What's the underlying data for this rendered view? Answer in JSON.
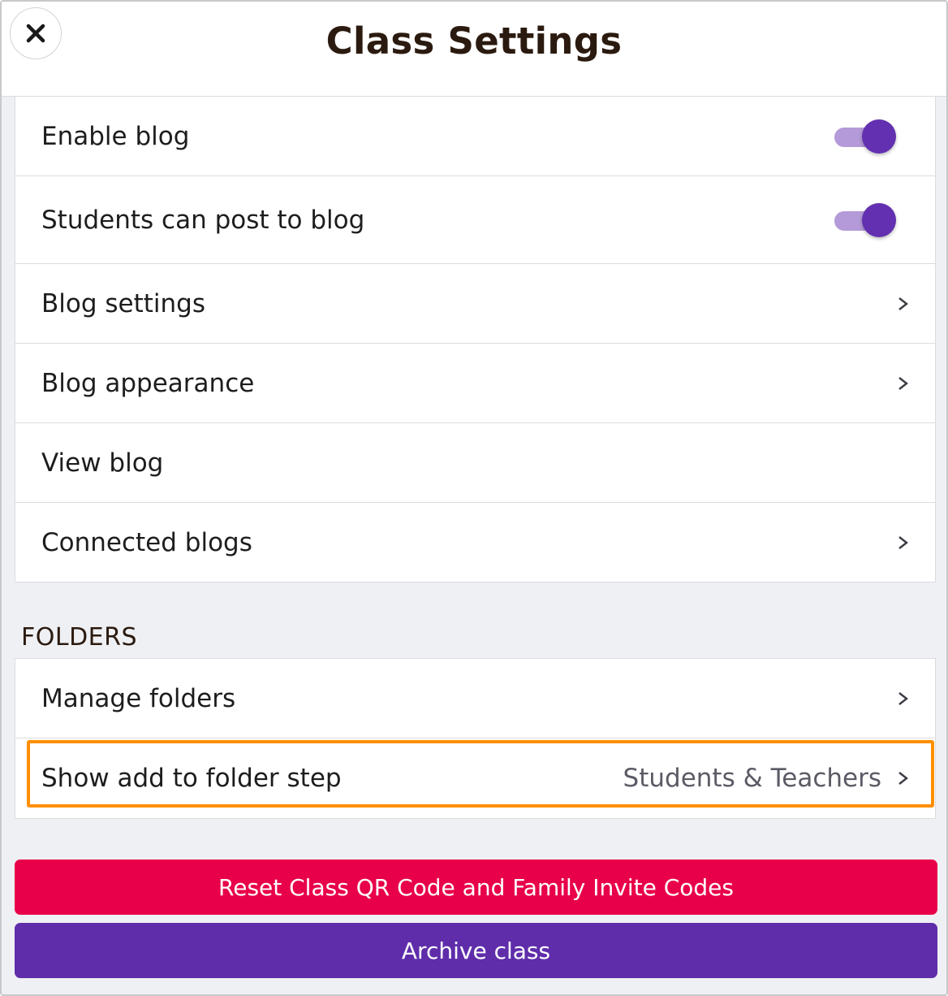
{
  "header": {
    "title": "Class Settings",
    "close_icon": "close-icon"
  },
  "blog_settings": {
    "items": [
      {
        "label": "Enable blog",
        "control": "toggle",
        "on": true
      },
      {
        "label": "Students can post to blog",
        "control": "toggle",
        "on": true
      },
      {
        "label": "Blog settings",
        "control": "chevron",
        "chevron": ">"
      },
      {
        "label": "Blog appearance",
        "control": "chevron",
        "chevron": ">"
      },
      {
        "label": "View blog",
        "control": "none"
      },
      {
        "label": "Connected blogs",
        "control": "chevron",
        "chevron": ">"
      }
    ]
  },
  "folders": {
    "heading": "FOLDERS",
    "items": [
      {
        "label": "Manage folders",
        "control": "chevron",
        "chevron": ">"
      },
      {
        "label": "Show add to folder step",
        "value": "Students & Teachers",
        "control": "chevron",
        "chevron": ">",
        "highlighted": true
      }
    ]
  },
  "actions": {
    "reset_label": "Reset Class QR Code and Family Invite Codes",
    "archive_label": "Archive class"
  },
  "colors": {
    "toggle_on": "#6230b0",
    "toggle_track": "#b49ad8",
    "reset_button": "#e8004a",
    "archive_button": "#5f2daa",
    "highlight_outline": "#ff8f00"
  }
}
